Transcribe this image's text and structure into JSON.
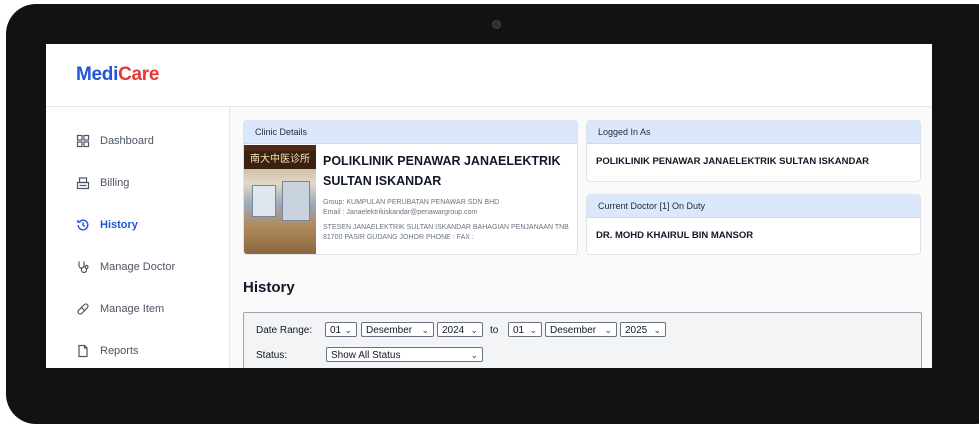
{
  "app": {
    "logo_part1": "Medi",
    "logo_part2": "Care"
  },
  "sidebar": {
    "items": [
      {
        "label": "Dashboard",
        "icon": "grid-icon"
      },
      {
        "label": "Billing",
        "icon": "cash-register-icon"
      },
      {
        "label": "History",
        "icon": "history-icon",
        "active": true
      },
      {
        "label": "Manage Doctor",
        "icon": "stethoscope-icon"
      },
      {
        "label": "Manage Item",
        "icon": "pill-icon"
      },
      {
        "label": "Reports",
        "icon": "document-icon"
      }
    ]
  },
  "clinic": {
    "header": "Clinic Details",
    "image_sign": "南大中医诊所",
    "name": "POLIKLINIK PENAWAR JANAELEKTRIK SULTAN ISKANDAR",
    "group": "Group: KUMPULAN PERUBATAN PENAWAR SDN BHD",
    "email": "Email : Janaelektrikiskandar@penawargroup.com",
    "address": "STESEN JANAELEKTRIK SULTAN ISKANDAR BAHAGIAN PENJANAAN TNB 81700 PASIR GUDANG JOHOR  PHONE :  FAX :"
  },
  "logged_in": {
    "header": "Logged In As",
    "value": "POLIKLINIK PENAWAR JANAELEKTRIK SULTAN ISKANDAR"
  },
  "doctor": {
    "header": "Current Doctor [1] On Duty",
    "value": "DR. MOHD KHAIRUL BIN MANSOR"
  },
  "history": {
    "title": "History",
    "date_range_label": "Date Range:",
    "to_label": "to",
    "from_day": "01",
    "from_month": "Desember",
    "from_year": "2024",
    "to_day": "01",
    "to_month": "Desember",
    "to_year": "2025",
    "status_label": "Status:",
    "status_value": "Show All Status"
  },
  "colors": {
    "brand_blue": "#1e56d6",
    "brand_red": "#e53935",
    "card_header": "#dbe7fb"
  }
}
